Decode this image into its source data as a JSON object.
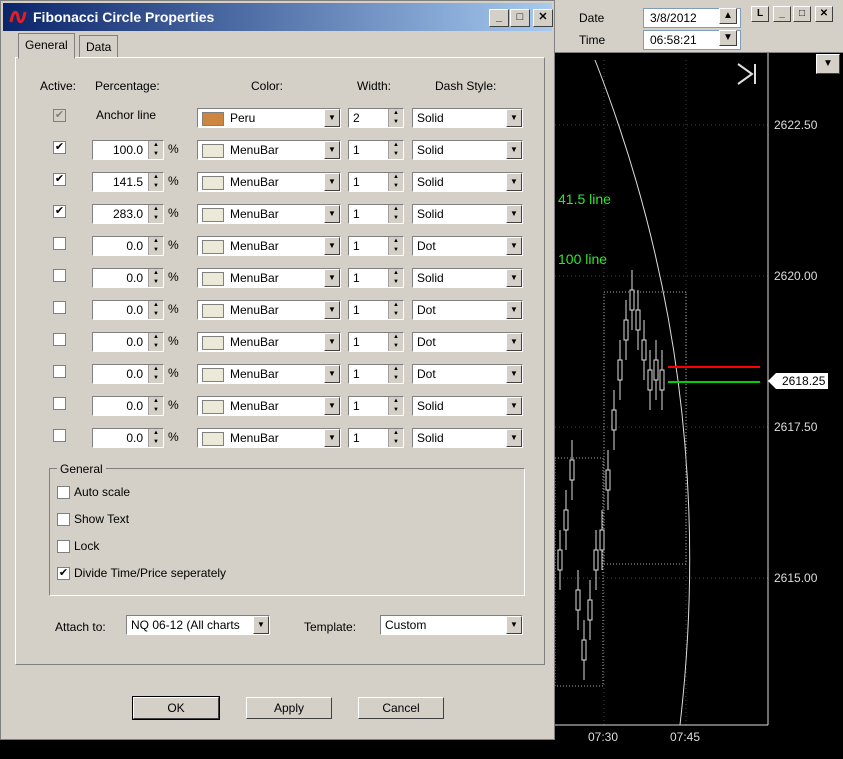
{
  "dialog": {
    "title": "Fibonacci Circle Properties",
    "tabs": [
      {
        "label": "General"
      },
      {
        "label": "Data"
      }
    ],
    "headers": {
      "active": "Active:",
      "percentage": "Percentage:",
      "color": "Color:",
      "width": "Width:",
      "dash": "Dash Style:"
    },
    "anchor": {
      "label": "Anchor line",
      "color": "Peru",
      "color_hex": "#cd853f",
      "width": "2",
      "dash": "Solid"
    },
    "rows": [
      {
        "checked": "✔",
        "pct": "100.0",
        "unit": "%",
        "color": "MenuBar",
        "width": "1",
        "dash": "Solid"
      },
      {
        "checked": "✔",
        "pct": "141.5",
        "unit": "%",
        "color": "MenuBar",
        "width": "1",
        "dash": "Solid"
      },
      {
        "checked": "✔",
        "pct": "283.0",
        "unit": "%",
        "color": "MenuBar",
        "width": "1",
        "dash": "Solid"
      },
      {
        "checked": "",
        "pct": "0.0",
        "unit": "%",
        "color": "MenuBar",
        "width": "1",
        "dash": "Dot"
      },
      {
        "checked": "",
        "pct": "0.0",
        "unit": "%",
        "color": "MenuBar",
        "width": "1",
        "dash": "Solid"
      },
      {
        "checked": "",
        "pct": "0.0",
        "unit": "%",
        "color": "MenuBar",
        "width": "1",
        "dash": "Dot"
      },
      {
        "checked": "",
        "pct": "0.0",
        "unit": "%",
        "color": "MenuBar",
        "width": "1",
        "dash": "Dot"
      },
      {
        "checked": "",
        "pct": "0.0",
        "unit": "%",
        "color": "MenuBar",
        "width": "1",
        "dash": "Dot"
      },
      {
        "checked": "",
        "pct": "0.0",
        "unit": "%",
        "color": "MenuBar",
        "width": "1",
        "dash": "Solid"
      },
      {
        "checked": "",
        "pct": "0.0",
        "unit": "%",
        "color": "MenuBar",
        "width": "1",
        "dash": "Solid"
      }
    ],
    "menubar_hex": "#ece9d8",
    "general_group": {
      "title": "General",
      "options": [
        {
          "label": "Auto scale",
          "checked": ""
        },
        {
          "label": "Show Text",
          "checked": ""
        },
        {
          "label": "Lock",
          "checked": ""
        },
        {
          "label": "Divide Time/Price seperately",
          "checked": "✔"
        }
      ]
    },
    "attach": {
      "label": "Attach to:",
      "value": "NQ 06-12 (All charts"
    },
    "template": {
      "label": "Template:",
      "value": "Custom"
    },
    "buttons": {
      "ok": "OK",
      "apply": "Apply",
      "cancel": "Cancel"
    }
  },
  "chart": {
    "date_label": "Date",
    "date_value": "3/8/2012",
    "time_label": "Time",
    "time_value": "06:58:21",
    "prices": [
      "2622.50",
      "2620.00",
      "2617.50",
      "2615.00"
    ],
    "last_price": "2618.25",
    "times": [
      "07:30",
      "07:45"
    ],
    "fib_labels": [
      "41.5 line",
      "100 line"
    ],
    "colors": {
      "fib_text": "#2ee62e",
      "red_line": "#ff0000",
      "green_line": "#00d000"
    }
  }
}
